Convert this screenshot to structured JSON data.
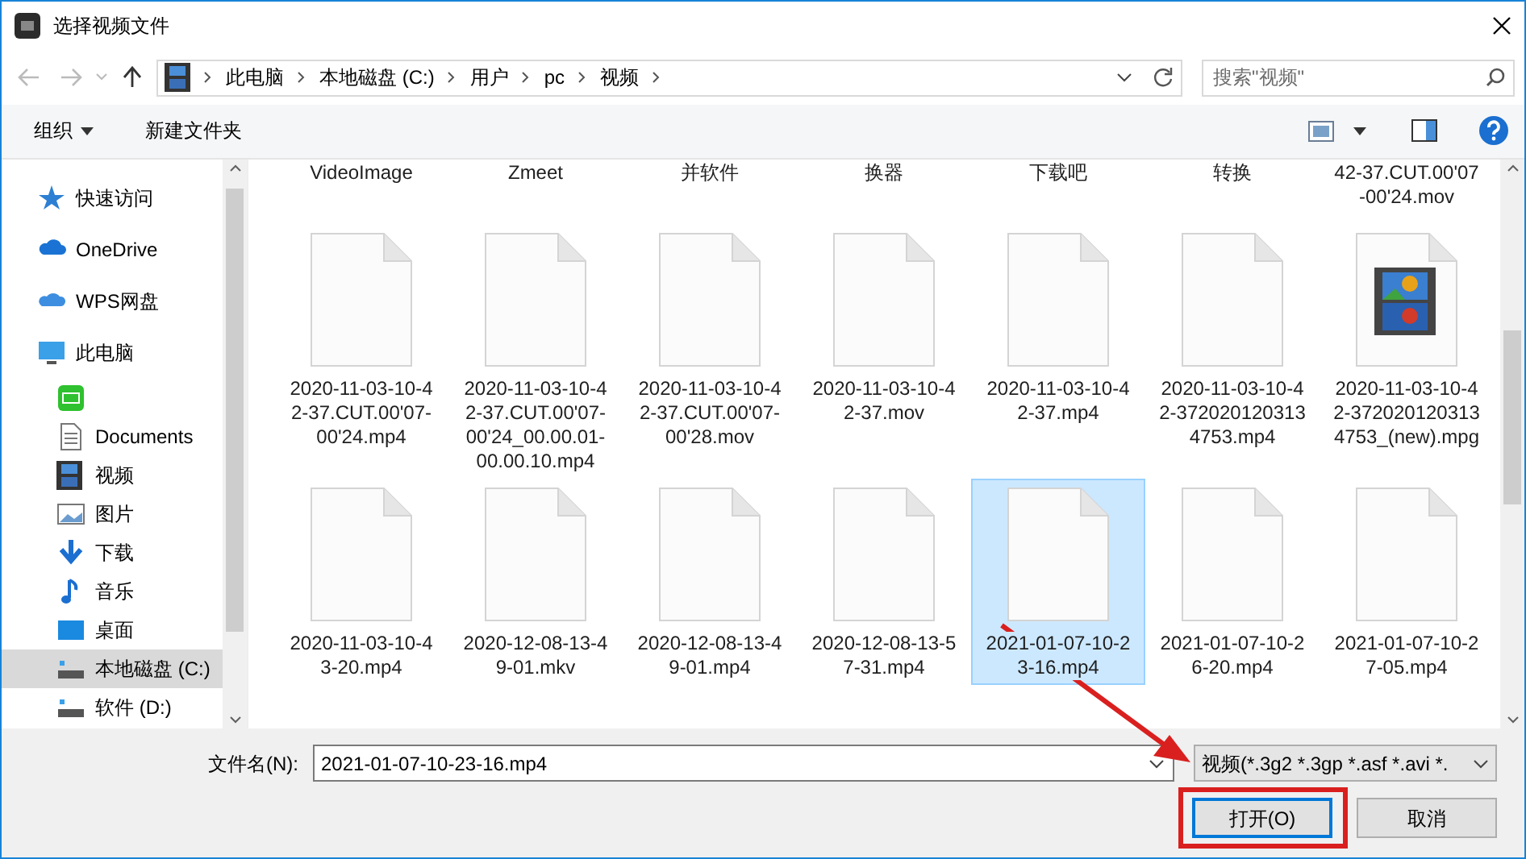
{
  "window": {
    "title": "选择视频文件"
  },
  "address_bar": {
    "path": [
      "此电脑",
      "本地磁盘 (C:)",
      "用户",
      "pc",
      "视频"
    ],
    "search": {
      "placeholder": "搜索\"视频\""
    }
  },
  "toolbar": {
    "organize": "组织",
    "new_folder": "新建文件夹"
  },
  "sidebar": {
    "items": [
      {
        "label": "快速访问",
        "kind": "star",
        "selected": false
      },
      {
        "label": "OneDrive",
        "kind": "cloud",
        "selected": false
      },
      {
        "label": "WPS网盘",
        "kind": "wps",
        "selected": false
      },
      {
        "label": "此电脑",
        "kind": "pc",
        "selected": false,
        "children": [
          {
            "kind": "app",
            "selected": false
          },
          {
            "label": "Documents",
            "kind": "doc",
            "selected": false
          },
          {
            "label": "视频",
            "kind": "video",
            "selected": false
          },
          {
            "label": "图片",
            "kind": "picture",
            "selected": false
          },
          {
            "label": "下载",
            "kind": "download",
            "selected": false
          },
          {
            "label": "音乐",
            "kind": "music",
            "selected": false
          },
          {
            "label": "桌面",
            "kind": "desktop",
            "selected": false
          },
          {
            "label": "本地磁盘 (C:)",
            "kind": "drive",
            "selected": true
          },
          {
            "label": "软件 (D:)",
            "kind": "drive",
            "selected": false
          }
        ]
      }
    ]
  },
  "files": [
    {
      "name": "VideoImage",
      "kind": "cut",
      "selected": false
    },
    {
      "name": "Zmeet",
      "kind": "cut",
      "selected": false
    },
    {
      "name": "并软件",
      "kind": "cut",
      "selected": false
    },
    {
      "name": "换器",
      "kind": "cut",
      "selected": false
    },
    {
      "name": "下载吧",
      "kind": "cut",
      "selected": false
    },
    {
      "name": "转换",
      "kind": "cut",
      "selected": false
    },
    {
      "name": "42-37.CUT.00'07-00'24.mov",
      "kind": "cut",
      "selected": false
    },
    {
      "name": "2020-11-03-10-42-37.CUT.00'07-00'24.mp4",
      "kind": "blank",
      "selected": false
    },
    {
      "name": "2020-11-03-10-42-37.CUT.00'07-00'24_00.00.01-00.00.10.mp4",
      "kind": "blank",
      "selected": false
    },
    {
      "name": "2020-11-03-10-42-37.CUT.00'07-00'28.mov",
      "kind": "blank",
      "selected": false
    },
    {
      "name": "2020-11-03-10-42-37.mov",
      "kind": "blank",
      "selected": false
    },
    {
      "name": "2020-11-03-10-42-37.mp4",
      "kind": "blank",
      "selected": false
    },
    {
      "name": "2020-11-03-10-42-3720201203134753.mp4",
      "kind": "blank",
      "selected": false
    },
    {
      "name": "2020-11-03-10-42-3720201203134753_(new).mpg",
      "kind": "video",
      "selected": false
    },
    {
      "name": "2020-11-03-10-43-20.mp4",
      "kind": "blank",
      "selected": false
    },
    {
      "name": "2020-12-08-13-49-01.mkv",
      "kind": "blank",
      "selected": false
    },
    {
      "name": "2020-12-08-13-49-01.mp4",
      "kind": "blank",
      "selected": false
    },
    {
      "name": "2020-12-08-13-57-31.mp4",
      "kind": "blank",
      "selected": false
    },
    {
      "name": "2021-01-07-10-23-16.mp4",
      "kind": "blank",
      "selected": true
    },
    {
      "name": "2021-01-07-10-26-20.mp4",
      "kind": "blank",
      "selected": false
    },
    {
      "name": "2021-01-07-10-27-05.mp4",
      "kind": "blank",
      "selected": false
    }
  ],
  "footer": {
    "filename_label": "文件名(N):",
    "filename": "2021-01-07-10-23-16.mp4",
    "filter": "视频(*.3g2 *.3gp *.asf *.avi *.",
    "buttons": [
      {
        "label": "打开(O)",
        "kind": "primary"
      },
      {
        "label": "取消",
        "kind": "default"
      }
    ]
  }
}
